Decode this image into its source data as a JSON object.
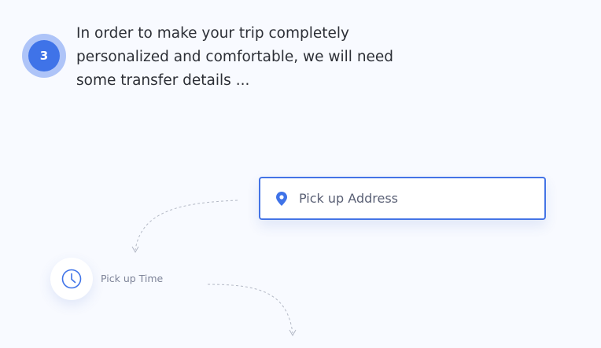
{
  "step": {
    "number": "3",
    "intro_text": "In order to make your trip completely personalized and comfortable, we will need some transfer details ..."
  },
  "pickup_address": {
    "placeholder": "Pick up Address",
    "icon": "map-pin-icon"
  },
  "pickup_time": {
    "label": "Pick up Time",
    "icon": "clock-icon"
  },
  "colors": {
    "accent": "#3f73e8",
    "accent_light": "#aec4f8",
    "background": "#f8faff",
    "text": "#2c2f36",
    "muted": "#7d8398"
  }
}
